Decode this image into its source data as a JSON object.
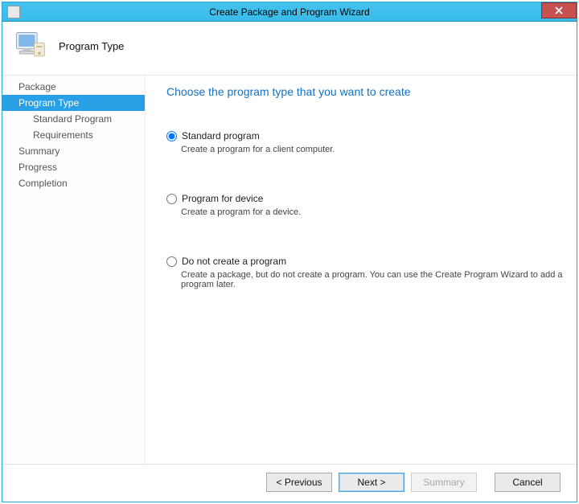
{
  "window": {
    "title": "Create Package and Program Wizard"
  },
  "header": {
    "title": "Program Type"
  },
  "nav": {
    "items": [
      {
        "label": "Package",
        "selected": false,
        "indent": false
      },
      {
        "label": "Program Type",
        "selected": true,
        "indent": false
      },
      {
        "label": "Standard Program",
        "selected": false,
        "indent": true
      },
      {
        "label": "Requirements",
        "selected": false,
        "indent": true
      },
      {
        "label": "Summary",
        "selected": false,
        "indent": false
      },
      {
        "label": "Progress",
        "selected": false,
        "indent": false
      },
      {
        "label": "Completion",
        "selected": false,
        "indent": false
      }
    ]
  },
  "content": {
    "heading": "Choose the program type that you want to create",
    "options": [
      {
        "label": "Standard program",
        "description": "Create a program for a client computer.",
        "selected": true
      },
      {
        "label": "Program for device",
        "description": "Create a program for a device.",
        "selected": false
      },
      {
        "label": "Do not create a program",
        "description": "Create a package, but do not create a program. You can use the Create Program Wizard to add a program later.",
        "selected": false
      }
    ]
  },
  "footer": {
    "previous": "< Previous",
    "next": "Next >",
    "summary": "Summary",
    "cancel": "Cancel"
  }
}
